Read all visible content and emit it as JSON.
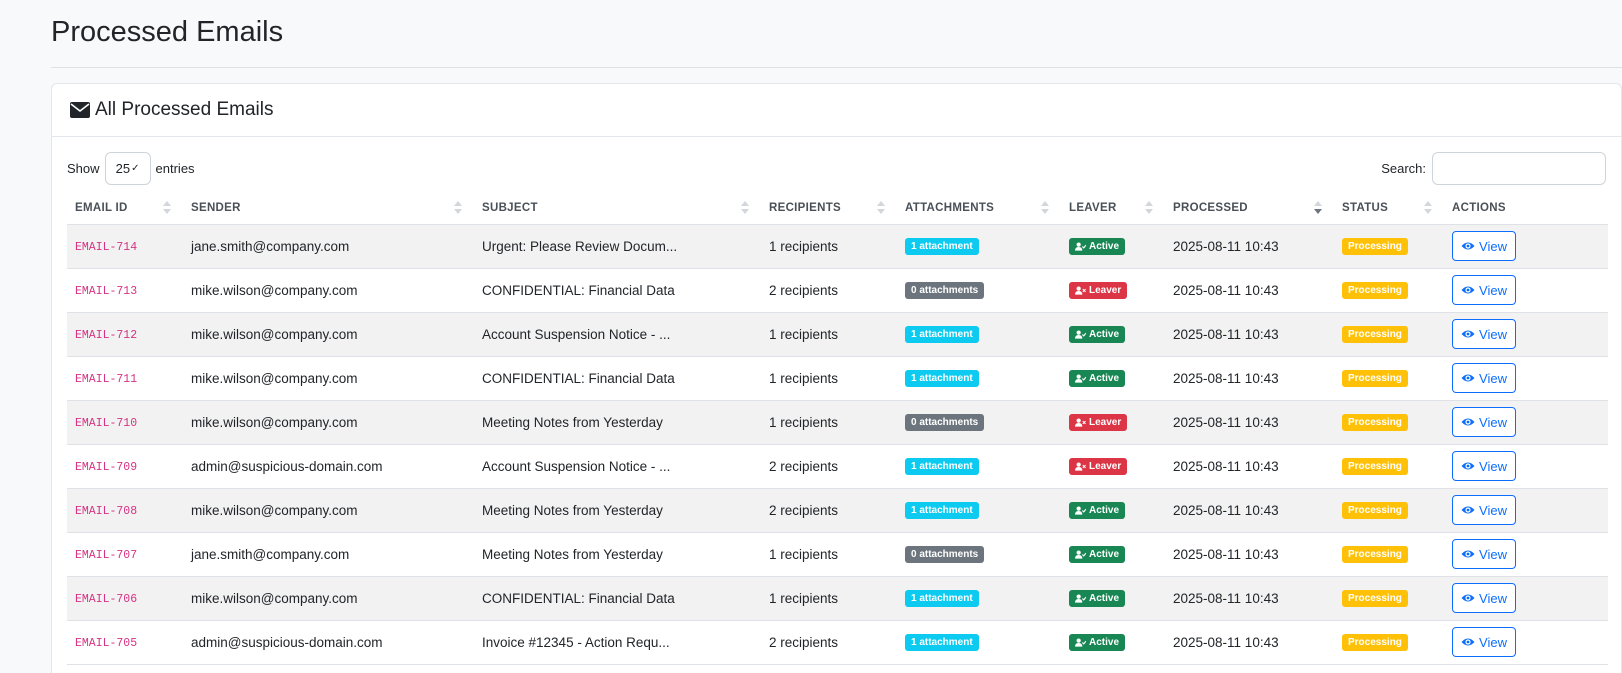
{
  "page": {
    "title": "Processed Emails"
  },
  "card": {
    "title": "All Processed Emails",
    "icon": "envelope-icon"
  },
  "controls": {
    "show_label": "Show",
    "length_value": "25",
    "entries_label": "entries",
    "search_label": "Search:",
    "search_value": ""
  },
  "columns": [
    "EMAIL ID",
    "SENDER",
    "SUBJECT",
    "RECIPIENTS",
    "ATTACHMENTS",
    "LEAVER",
    "PROCESSED",
    "STATUS",
    "ACTIONS"
  ],
  "sorted_column": "PROCESSED",
  "colors": {
    "email_id": "#d63384",
    "info": "#0dcaf0",
    "secondary": "#6c757d",
    "success": "#198754",
    "danger": "#dc3545",
    "warning": "#ffc107",
    "primary": "#0d6efd"
  },
  "rows": [
    {
      "id": "EMAIL-714",
      "sender": "jane.smith@company.com",
      "subject": "Urgent: Please Review Docum...",
      "recipients": "1 recipients",
      "attachments": "1 attachment",
      "leaver": "Active",
      "processed": "2025-08-11 10:43",
      "status": "Processing",
      "action": "View"
    },
    {
      "id": "EMAIL-713",
      "sender": "mike.wilson@company.com",
      "subject": "CONFIDENTIAL: Financial Data",
      "recipients": "2 recipients",
      "attachments": "0 attachments",
      "leaver": "Leaver",
      "processed": "2025-08-11 10:43",
      "status": "Processing",
      "action": "View"
    },
    {
      "id": "EMAIL-712",
      "sender": "mike.wilson@company.com",
      "subject": "Account Suspension Notice - ...",
      "recipients": "1 recipients",
      "attachments": "1 attachment",
      "leaver": "Active",
      "processed": "2025-08-11 10:43",
      "status": "Processing",
      "action": "View"
    },
    {
      "id": "EMAIL-711",
      "sender": "mike.wilson@company.com",
      "subject": "CONFIDENTIAL: Financial Data",
      "recipients": "1 recipients",
      "attachments": "1 attachment",
      "leaver": "Active",
      "processed": "2025-08-11 10:43",
      "status": "Processing",
      "action": "View"
    },
    {
      "id": "EMAIL-710",
      "sender": "mike.wilson@company.com",
      "subject": "Meeting Notes from Yesterday",
      "recipients": "1 recipients",
      "attachments": "0 attachments",
      "leaver": "Leaver",
      "processed": "2025-08-11 10:43",
      "status": "Processing",
      "action": "View"
    },
    {
      "id": "EMAIL-709",
      "sender": "admin@suspicious-domain.com",
      "subject": "Account Suspension Notice - ...",
      "recipients": "2 recipients",
      "attachments": "1 attachment",
      "leaver": "Leaver",
      "processed": "2025-08-11 10:43",
      "status": "Processing",
      "action": "View"
    },
    {
      "id": "EMAIL-708",
      "sender": "mike.wilson@company.com",
      "subject": "Meeting Notes from Yesterday",
      "recipients": "2 recipients",
      "attachments": "1 attachment",
      "leaver": "Active",
      "processed": "2025-08-11 10:43",
      "status": "Processing",
      "action": "View"
    },
    {
      "id": "EMAIL-707",
      "sender": "jane.smith@company.com",
      "subject": "Meeting Notes from Yesterday",
      "recipients": "1 recipients",
      "attachments": "0 attachments",
      "leaver": "Active",
      "processed": "2025-08-11 10:43",
      "status": "Processing",
      "action": "View"
    },
    {
      "id": "EMAIL-706",
      "sender": "mike.wilson@company.com",
      "subject": "CONFIDENTIAL: Financial Data",
      "recipients": "1 recipients",
      "attachments": "1 attachment",
      "leaver": "Active",
      "processed": "2025-08-11 10:43",
      "status": "Processing",
      "action": "View"
    },
    {
      "id": "EMAIL-705",
      "sender": "admin@suspicious-domain.com",
      "subject": "Invoice #12345 - Action Requ...",
      "recipients": "2 recipients",
      "attachments": "1 attachment",
      "leaver": "Active",
      "processed": "2025-08-11 10:43",
      "status": "Processing",
      "action": "View"
    }
  ]
}
